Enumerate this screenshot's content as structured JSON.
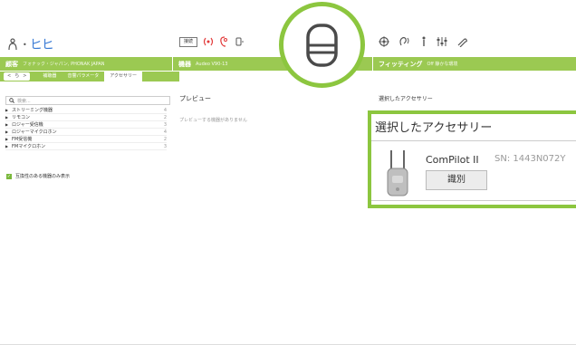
{
  "toolbar": {
    "logo_text": "ヒヒ",
    "connect_label": "接続",
    "icons_left": [
      "connect-device-icon",
      "hearing-aid-icon",
      "remote-icon"
    ],
    "icons_right": [
      "target-icon",
      "ear-icon",
      "person-icon",
      "sliders-icon",
      "tools-icon"
    ]
  },
  "greenbar": {
    "client_label": "顧客",
    "client_sub": "フォナック・ジャパン, PHONAK JAPAN",
    "devices_label": "機器",
    "devices_sub": "Audeo V90-13",
    "fitting_label": "フィッティング",
    "fitting_sub": "Off 静かな環境"
  },
  "tabs": {
    "nav_back": "<",
    "nav_mid": "ち",
    "nav_fwd": ">",
    "items": [
      {
        "label": "補聴器",
        "active": false
      },
      {
        "label": "音響パラメータ",
        "active": false
      },
      {
        "label": "アクセサリー",
        "active": true
      }
    ]
  },
  "left": {
    "search_placeholder": "検索...",
    "categories": [
      {
        "name": "ストリーミング機器",
        "count": "4"
      },
      {
        "name": "リモコン",
        "count": "2"
      },
      {
        "name": "ロジャー受信機",
        "count": "3"
      },
      {
        "name": "ロジャーマイクロホン",
        "count": "4"
      },
      {
        "name": "FM受信機",
        "count": "2"
      },
      {
        "name": "FMマイクロホン",
        "count": "3"
      }
    ],
    "compat_label": "互換性のある機器のみ表示"
  },
  "preview": {
    "title": "プレビュー",
    "empty_text": "プレビューする機器がありません"
  },
  "selected": {
    "title": "選択したアクセサリー",
    "zoom_title": "選択したアクセサリー",
    "device_name": "ComPilot II",
    "serial": "SN: 1443N072Y",
    "identify_label": "識別"
  },
  "colors": {
    "accent_green": "#9bc952",
    "callout_green": "#8cc63f"
  }
}
